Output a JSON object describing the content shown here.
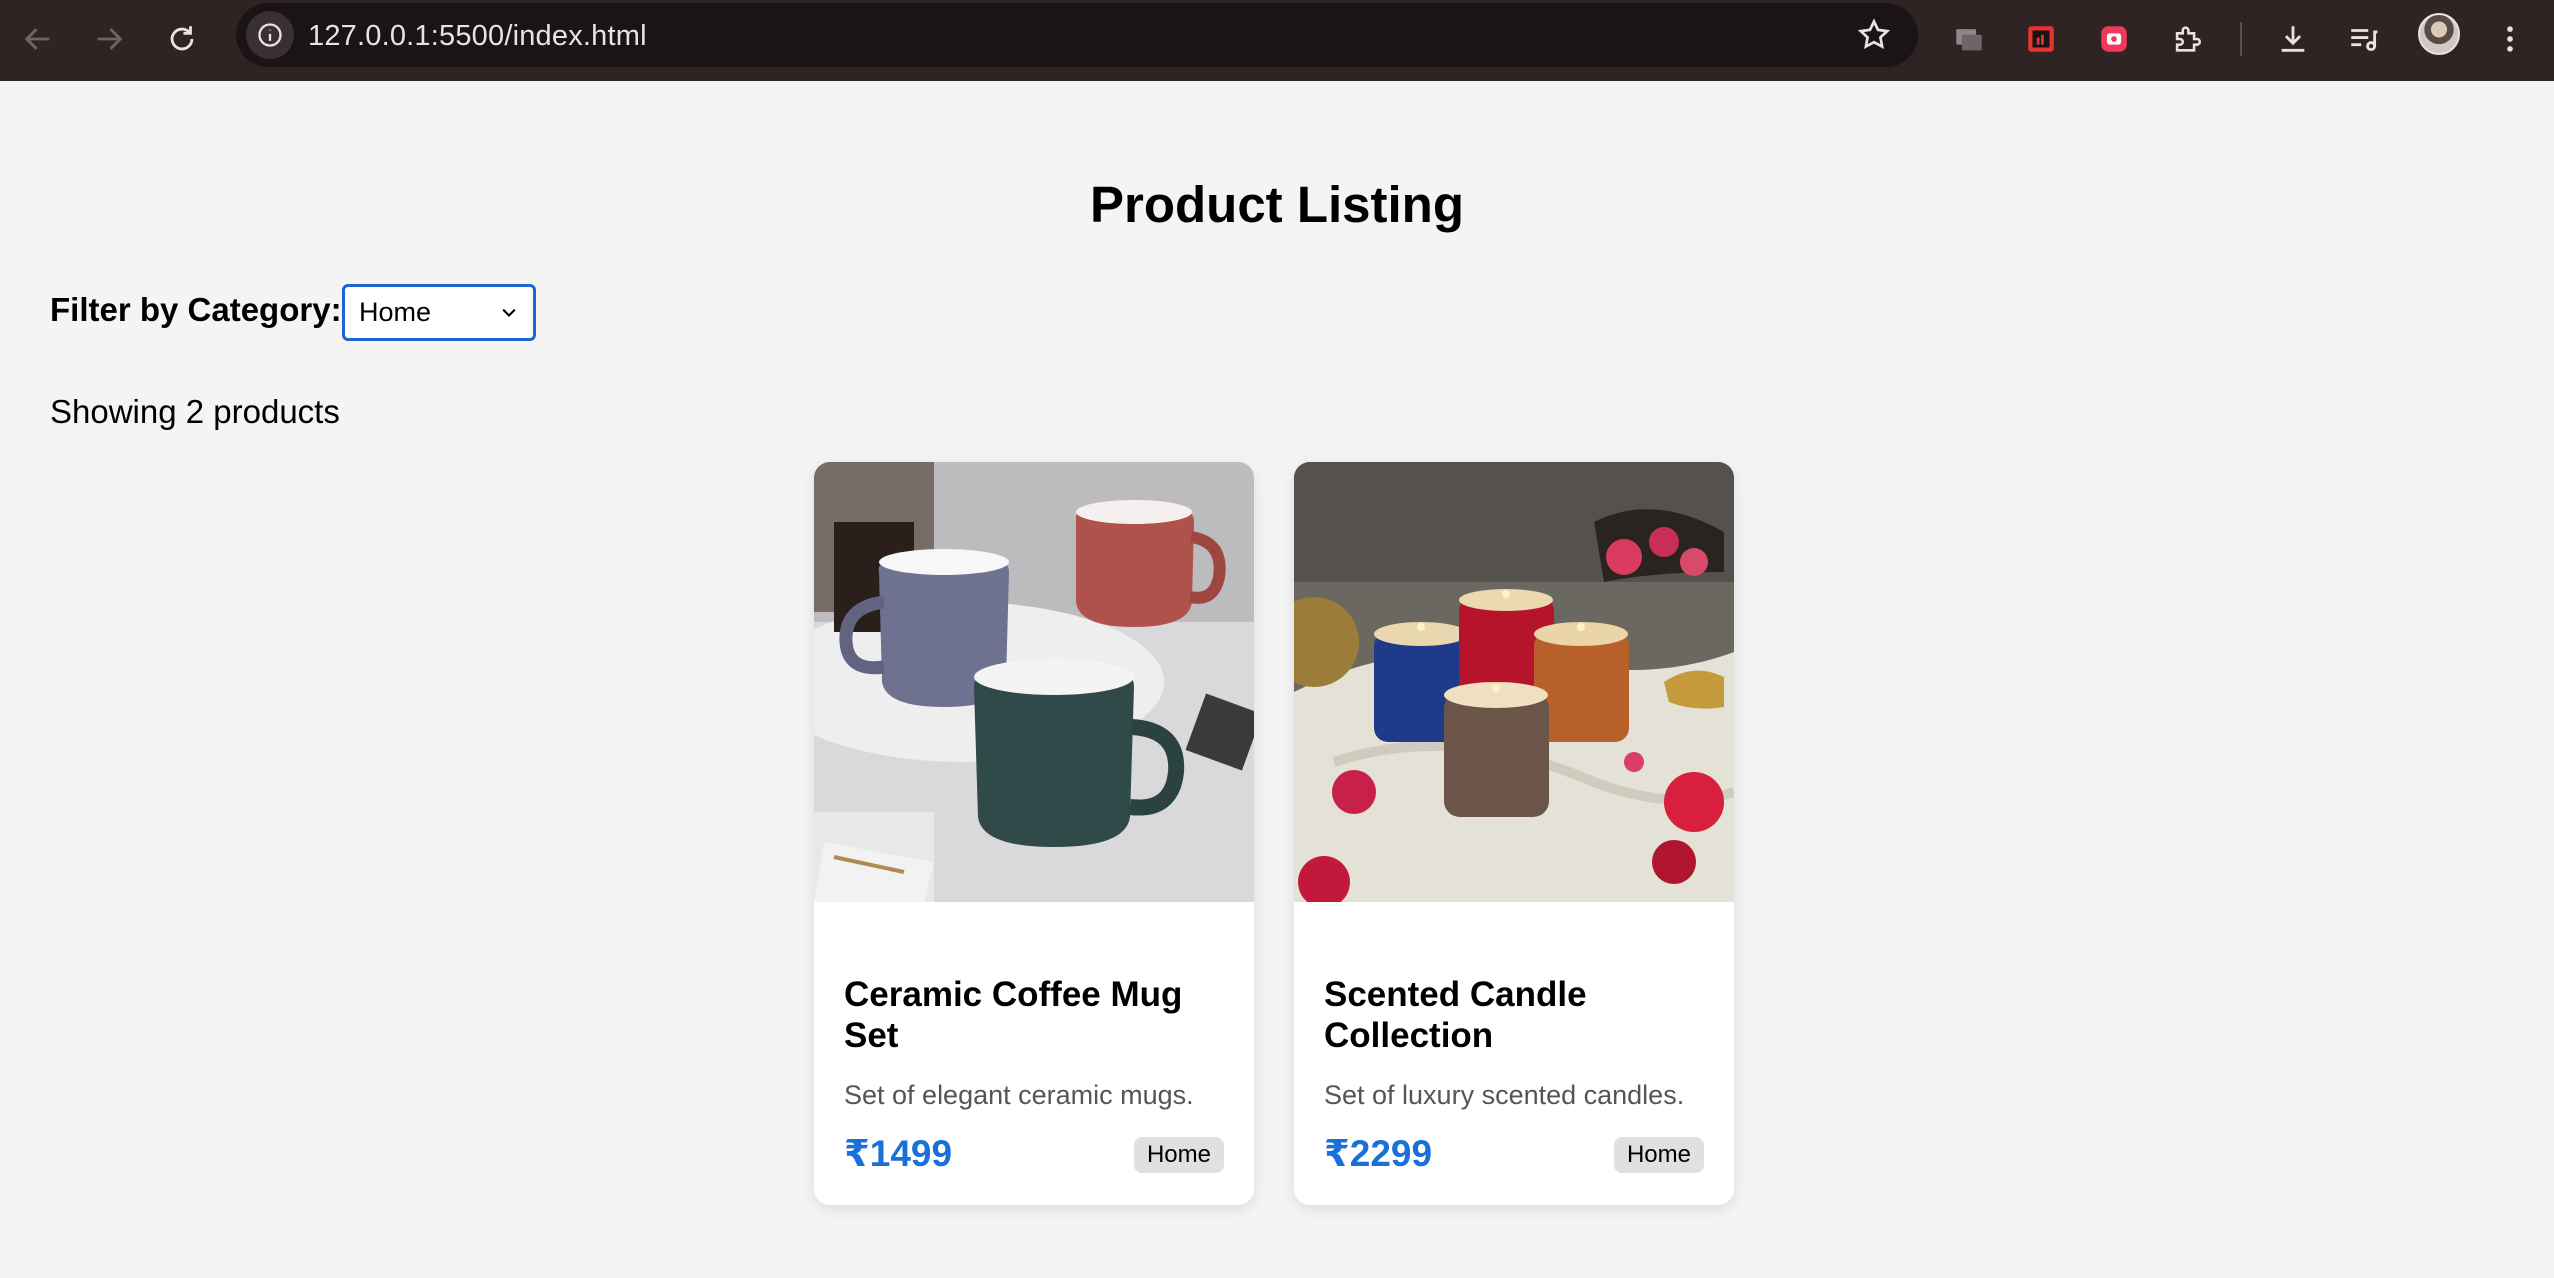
{
  "browser": {
    "url": "127.0.0.1:5500/index.html",
    "icons": [
      "back-icon",
      "forward-icon",
      "reload-icon",
      "site-info-icon",
      "bookmark-star-icon",
      "tab-search-icon",
      "pdf-extension-icon",
      "record-extension-icon",
      "extensions-puzzle-icon",
      "downloads-icon",
      "media-queue-icon",
      "profile-avatar",
      "menu-kebab-icon"
    ]
  },
  "page": {
    "title": "Product Listing",
    "filter_label": "Filter by Category:",
    "filter_selected": "Home",
    "count_text": "Showing 2 products"
  },
  "products": [
    {
      "name": "Ceramic Coffee Mug Set",
      "description": "Set of elegant ceramic mugs.",
      "price": "₹1499",
      "category": "Home",
      "image": "ceramic-mugs-photo"
    },
    {
      "name": "Scented Candle Collection",
      "description": "Set of luxury scented candles.",
      "price": "₹2299",
      "category": "Home",
      "image": "scented-candles-photo"
    }
  ],
  "colors": {
    "chrome_bg": "#2f2324",
    "page_bg": "#f4f4f4",
    "price": "#1a6fd8",
    "select_border": "#1a66d2",
    "badge_bg": "#e0e0e0"
  }
}
